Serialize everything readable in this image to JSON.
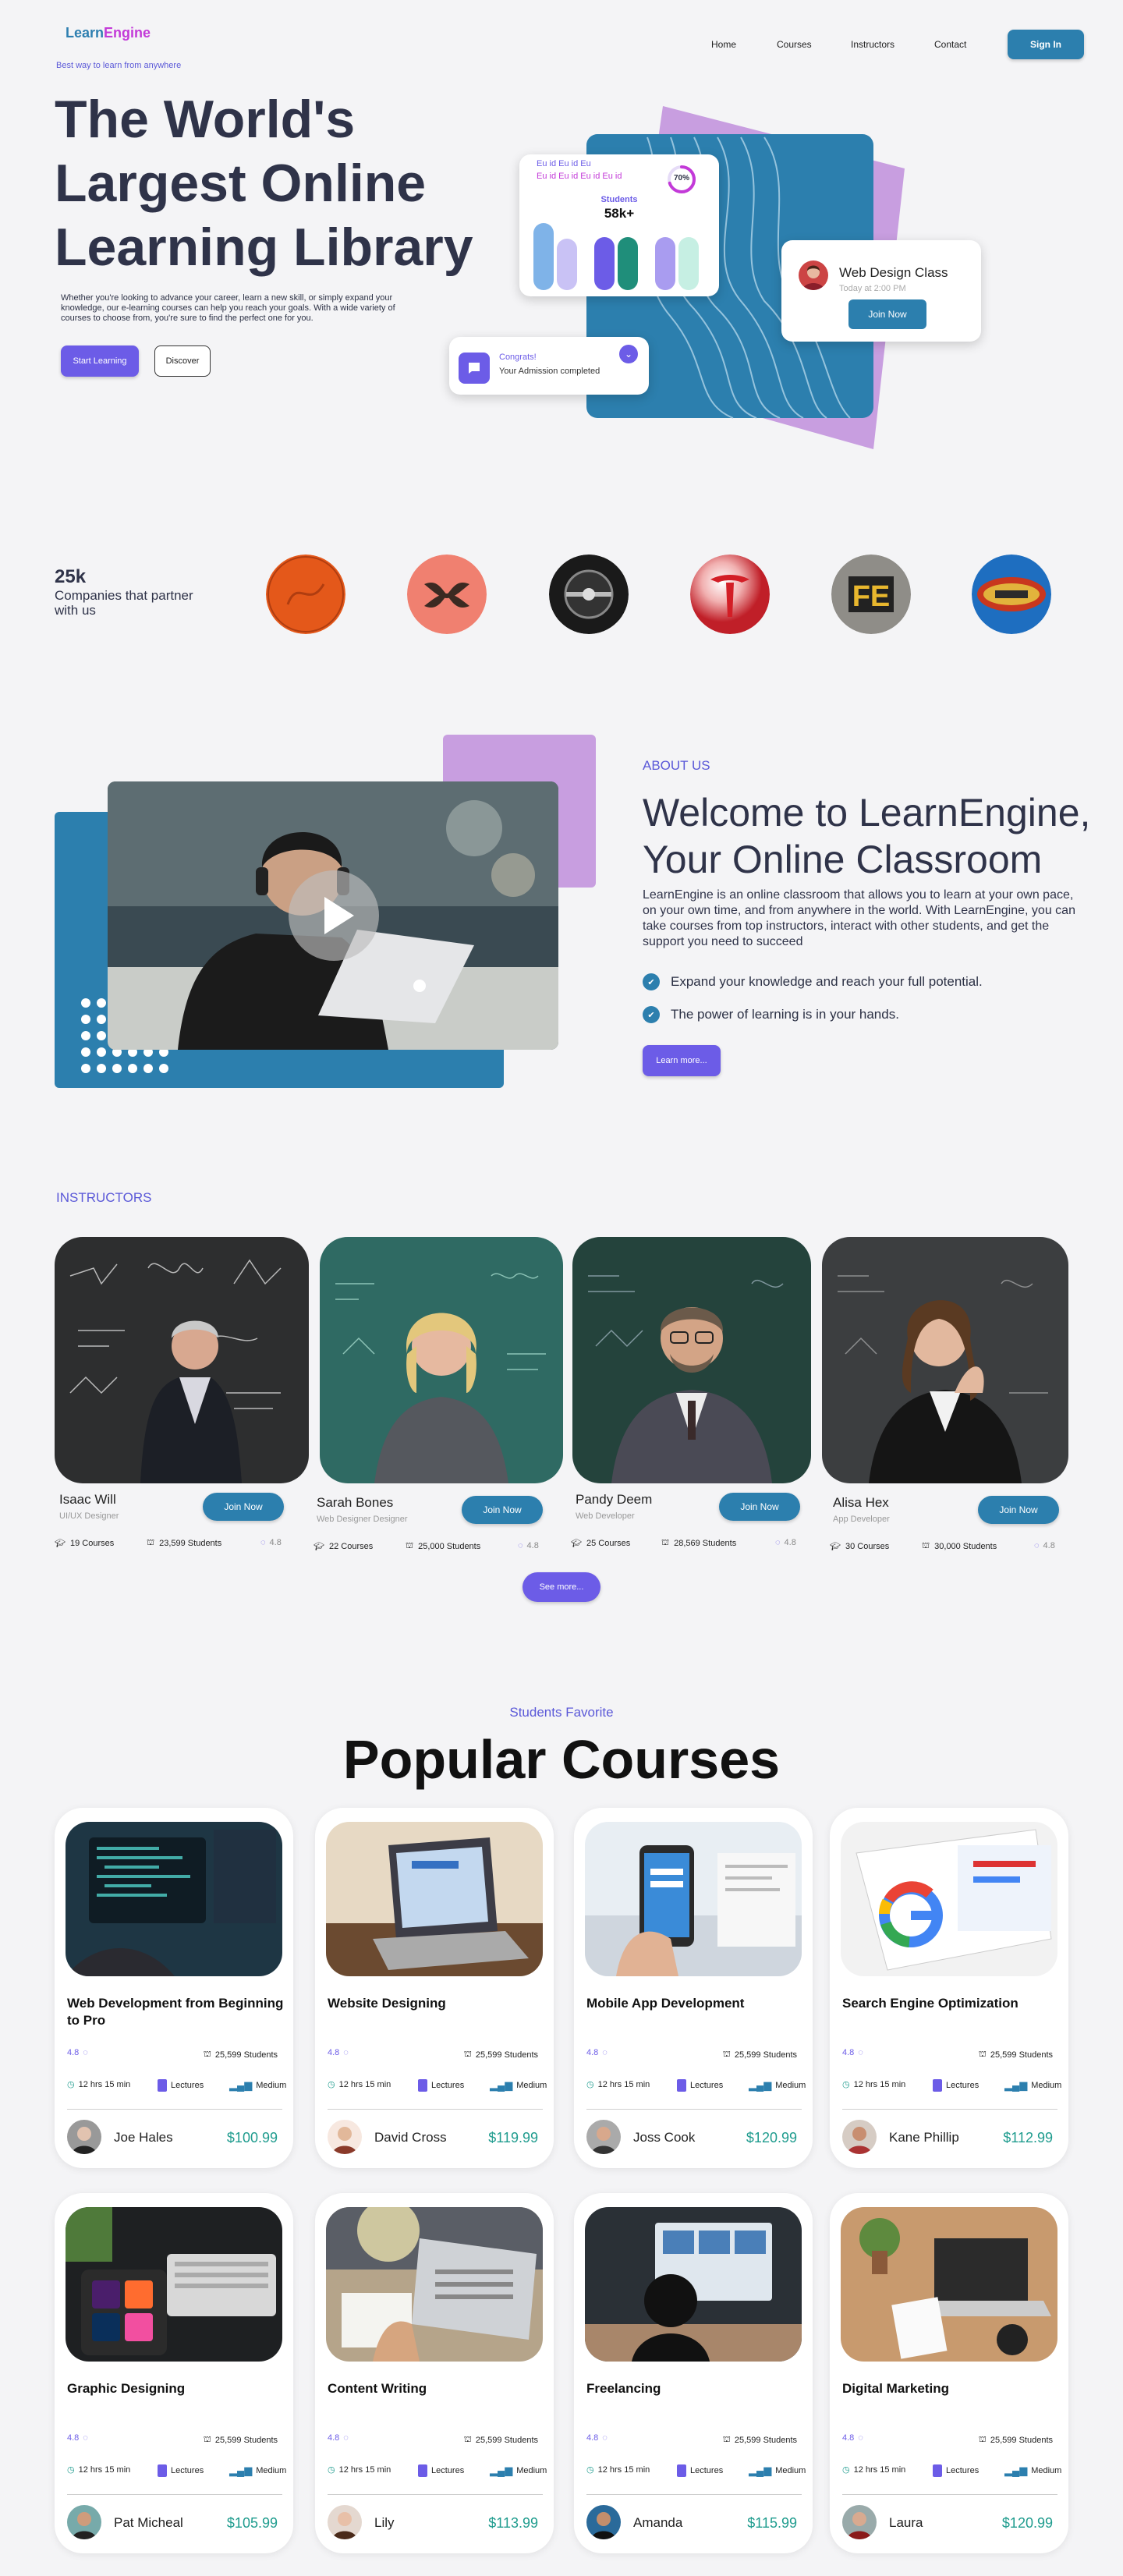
{
  "brand": {
    "part1": "Learn",
    "part2": "Engine",
    "tagline": "Best way to learn from anywhere"
  },
  "nav": {
    "items": [
      "Home",
      "Courses",
      "Instructors",
      "Contact"
    ],
    "signin": "Sign In"
  },
  "hero": {
    "title": "The World's Largest Online Learning Library",
    "description": "Whether you're looking to advance your career, learn a new skill, or simply expand your knowledge, our e-learning courses can help you reach your goals. With a wide variety of courses to choose from, you're sure to find the perfect one for you.",
    "start_button": "Start Learning",
    "discover_button": "Discover",
    "stats_card": {
      "line1": "Eu id Eu id Eu",
      "line2": "Eu id Eu id Eu id Eu id",
      "percent": "70%",
      "percent_value": 0.7,
      "label": "Students",
      "value": "58k+"
    },
    "class_card": {
      "title": "Web Design Class",
      "time": "Today at 2:00 PM",
      "button": "Join Now"
    },
    "admission_card": {
      "title": "Congrats!",
      "subtitle": "Your Admission completed"
    }
  },
  "partners": {
    "count": "25k",
    "label": "Companies that partner with us"
  },
  "about": {
    "eyebrow": "ABOUT US",
    "title": "Welcome to LearnEngine, Your Online Classroom",
    "description": "LearnEngine is an online classroom that allows you to learn at your own pace, on your own time, and from anywhere in the world. With LearnEngine, you can take courses from top instructors, interact with other students, and get the support you need to succeed",
    "points": [
      "Expand your knowledge and reach your full potential.",
      "The power of learning is in your hands."
    ],
    "button": "Learn more..."
  },
  "instructors": {
    "eyebrow": "INSTRUCTORS",
    "join_label": "Join Now",
    "see_more": "See more...",
    "items": [
      {
        "name": "Isaac Will",
        "role": "UI/UX Designer",
        "courses": "19 Courses",
        "students": "23,599 Students",
        "rating": "4.8"
      },
      {
        "name": "Sarah Bones",
        "role": "Web Designer Designer",
        "courses": "22 Courses",
        "students": "25,000 Students",
        "rating": "4.8"
      },
      {
        "name": "Pandy Deem",
        "role": "Web Developer",
        "courses": "25 Courses",
        "students": "28,569 Students",
        "rating": "4.8"
      },
      {
        "name": "Alisa Hex",
        "role": "App Developer",
        "courses": "30 Courses",
        "students": "30,000 Students",
        "rating": "4.8"
      }
    ]
  },
  "courses": {
    "eyebrow": "Students Favorite",
    "title": "Popular Courses",
    "meta": {
      "rating": "4.8",
      "students": "25,599 Students",
      "duration": "12 hrs 15 min",
      "lectures": "Lectures",
      "level": "Medium"
    },
    "items": [
      {
        "title": "Web Development from Beginning to Pro",
        "teacher": "Joe Hales",
        "price": "$100.99"
      },
      {
        "title": "Website Designing",
        "teacher": "David Cross",
        "price": "$119.99"
      },
      {
        "title": "Mobile App Development",
        "teacher": "Joss Cook",
        "price": "$120.99"
      },
      {
        "title": "Search Engine Optimization",
        "teacher": "Kane  Phillip",
        "price": "$112.99"
      },
      {
        "title": "Graphic Designing",
        "teacher": "Pat Micheal",
        "price": "$105.99"
      },
      {
        "title": "Content Writing",
        "teacher": "Lily",
        "price": "$113.99"
      },
      {
        "title": "Freelancing",
        "teacher": "Amanda",
        "price": "$115.99"
      },
      {
        "title": "Digital Marketing",
        "teacher": "Laura",
        "price": "$120.99"
      }
    ]
  },
  "colors": {
    "primary": "#2c7fae",
    "purple": "#6c5ce7",
    "lavender": "#c89ee0",
    "price": "#1f9c8e"
  }
}
